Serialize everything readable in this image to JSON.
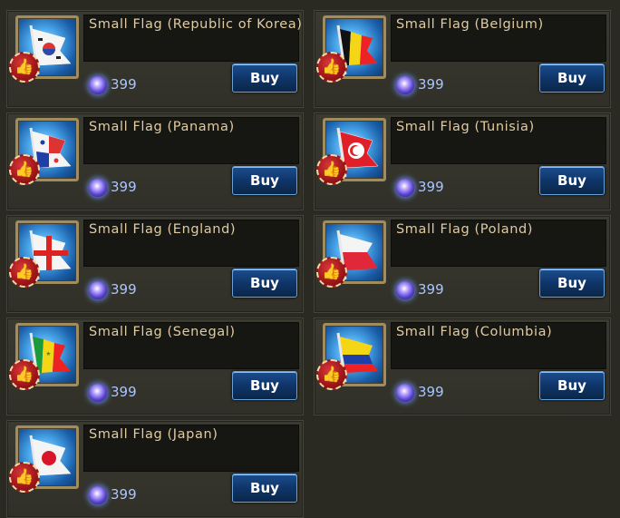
{
  "colors": {
    "background": "#2b2a22",
    "title_text": "#e0cba2",
    "price_text": "#a9c6ff",
    "button_fill": "#0f3569"
  },
  "items": [
    {
      "title": "Small Flag (Republic of Korea)",
      "price": "399",
      "buy_label": "Buy",
      "flag_icon": "flag-korea-icon"
    },
    {
      "title": "Small Flag (Belgium)",
      "price": "399",
      "buy_label": "Buy",
      "flag_icon": "flag-belgium-icon"
    },
    {
      "title": "Small Flag (Panama)",
      "price": "399",
      "buy_label": "Buy",
      "flag_icon": "flag-panama-icon"
    },
    {
      "title": "Small Flag (Tunisia)",
      "price": "399",
      "buy_label": "Buy",
      "flag_icon": "flag-tunisia-icon"
    },
    {
      "title": "Small Flag (England)",
      "price": "399",
      "buy_label": "Buy",
      "flag_icon": "flag-england-icon"
    },
    {
      "title": "Small Flag (Poland)",
      "price": "399",
      "buy_label": "Buy",
      "flag_icon": "flag-poland-icon"
    },
    {
      "title": "Small Flag (Senegal)",
      "price": "399",
      "buy_label": "Buy",
      "flag_icon": "flag-senegal-icon"
    },
    {
      "title": "Small Flag (Columbia)",
      "price": "399",
      "buy_label": "Buy",
      "flag_icon": "flag-columbia-icon"
    },
    {
      "title": "Small Flag (Japan)",
      "price": "399",
      "buy_label": "Buy",
      "flag_icon": "flag-japan-icon"
    }
  ],
  "icons": {
    "like": "thumbs-up-icon",
    "currency": "gem-currency-icon"
  }
}
